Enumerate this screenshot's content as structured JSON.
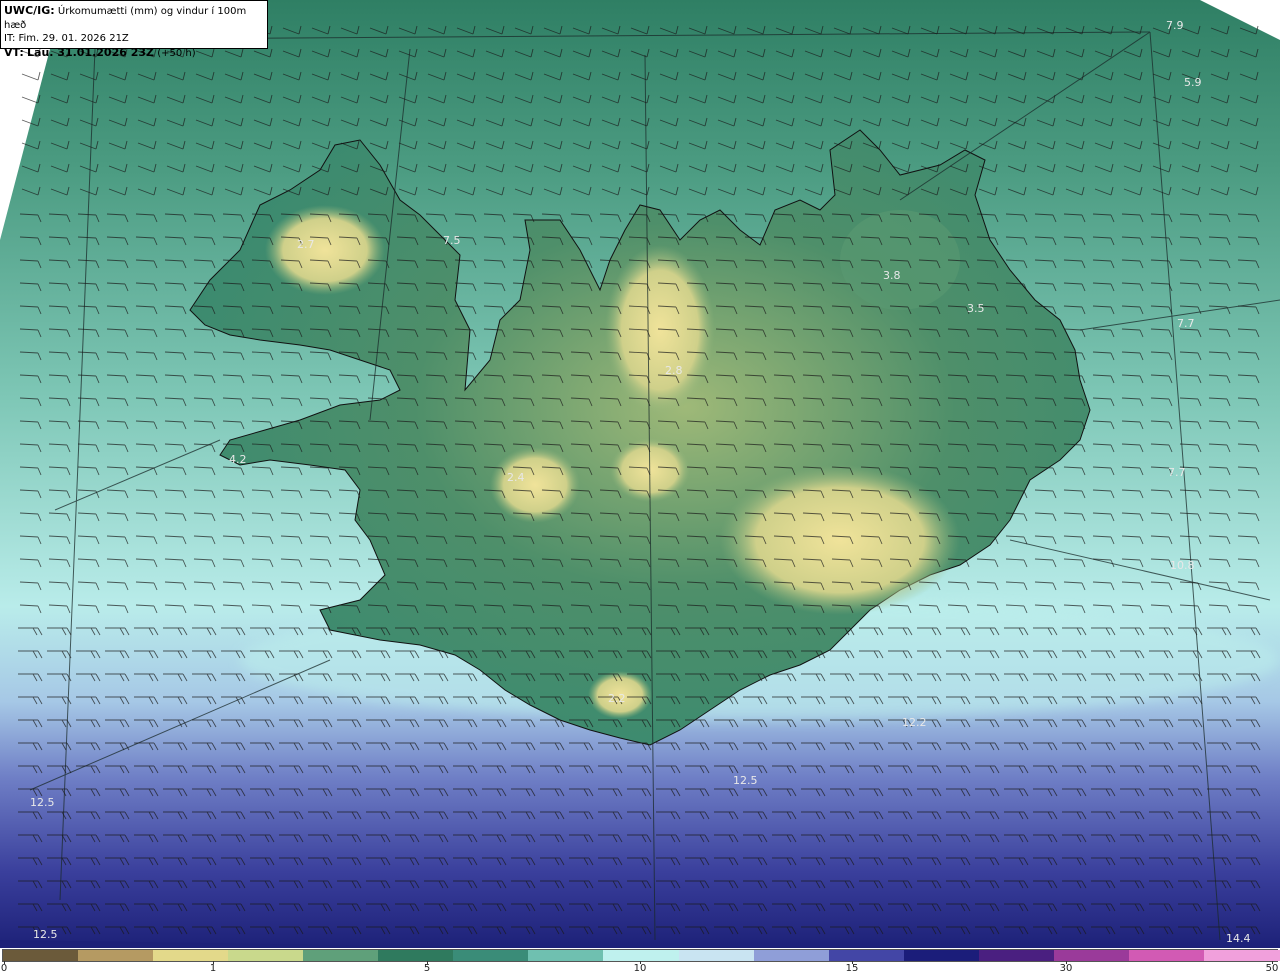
{
  "header": {
    "model": "UWC/IG:",
    "title": "Úrkomumætti (mm) og vindur í 100m hæð",
    "initial_time": "IT: Fim. 29. 01. 2026 21Z",
    "valid_prefix": "VT:",
    "valid_time": "Lau. 31.01.2026 23Z",
    "valid_offset": "(+50 h)"
  },
  "colorbar": {
    "ticks": [
      "0",
      "1",
      "5",
      "10",
      "15",
      "30",
      "50"
    ],
    "colors": [
      "#6b5a3a",
      "#b59a62",
      "#e3d98a",
      "#c9d98c",
      "#5fa07a",
      "#2f7a5e",
      "#3a8c78",
      "#6fc0b0",
      "#bff1ee",
      "#c9e4f2",
      "#8f9ed8",
      "#4346a6",
      "#1b1d7a",
      "#4a1f80",
      "#9a3a9a",
      "#d25ab4",
      "#f1a0dc"
    ]
  },
  "map_labels": [
    {
      "text": "7.9"
    },
    {
      "text": "5.9"
    },
    {
      "text": "2.7"
    },
    {
      "text": "7.5"
    },
    {
      "text": "3.8"
    },
    {
      "text": "3.5"
    },
    {
      "text": "7.7"
    },
    {
      "text": "2.8"
    },
    {
      "text": "4.2"
    },
    {
      "text": "2.4"
    },
    {
      "text": "7.7"
    },
    {
      "text": "10.8"
    },
    {
      "text": "2.2"
    },
    {
      "text": "12.2"
    },
    {
      "text": "12.5"
    },
    {
      "text": "12.5"
    },
    {
      "text": "12.5"
    },
    {
      "text": "14.4"
    }
  ],
  "colors": {
    "land_low": "#2f7a5e",
    "land_high": "#e3d98a",
    "sea_near": "#8fd4c8",
    "sea_far": "#2a2e8c"
  }
}
